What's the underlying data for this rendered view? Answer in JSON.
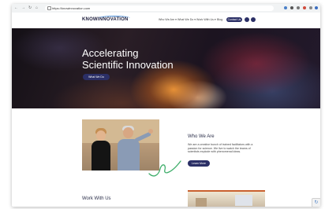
{
  "browser": {
    "url": "https://knowinnovation.com",
    "back_glyph": "←",
    "forward_glyph": "→",
    "reload_glyph": "↻",
    "home_glyph": "⌂",
    "extension_icons": [
      "extension-icon",
      "extension-icon",
      "extension-icon",
      "extension-icon",
      "extension-icon",
      "profile-icon"
    ],
    "extension_colors": [
      "#4a80c8",
      "#555555",
      "#777777",
      "#d04b3b",
      "#888888",
      "#3c6ec0"
    ]
  },
  "header": {
    "logo_text": "KNOWINNOVATION",
    "nav": [
      "Who We Are ▾",
      "What We Do ▾",
      "Work With Us ▾",
      "Blog"
    ],
    "contact_label": "Contact Us",
    "social_icons": [
      "linkedin-icon",
      "twitter-icon"
    ]
  },
  "hero": {
    "title_line1": "Accelerating",
    "title_line2": "Scientific Innovation",
    "button_label": "What We Do"
  },
  "about": {
    "title": "Who We Are",
    "text": "We are a creative bunch of trained facilitators with a passion for science. We live to watch the teams of scientists explode with phenomenal ideas.",
    "button_label": "Learn More"
  },
  "work": {
    "title": "Work With Us"
  },
  "colors": {
    "brand": "#2b2f66",
    "accent_green": "#3fae6b"
  }
}
